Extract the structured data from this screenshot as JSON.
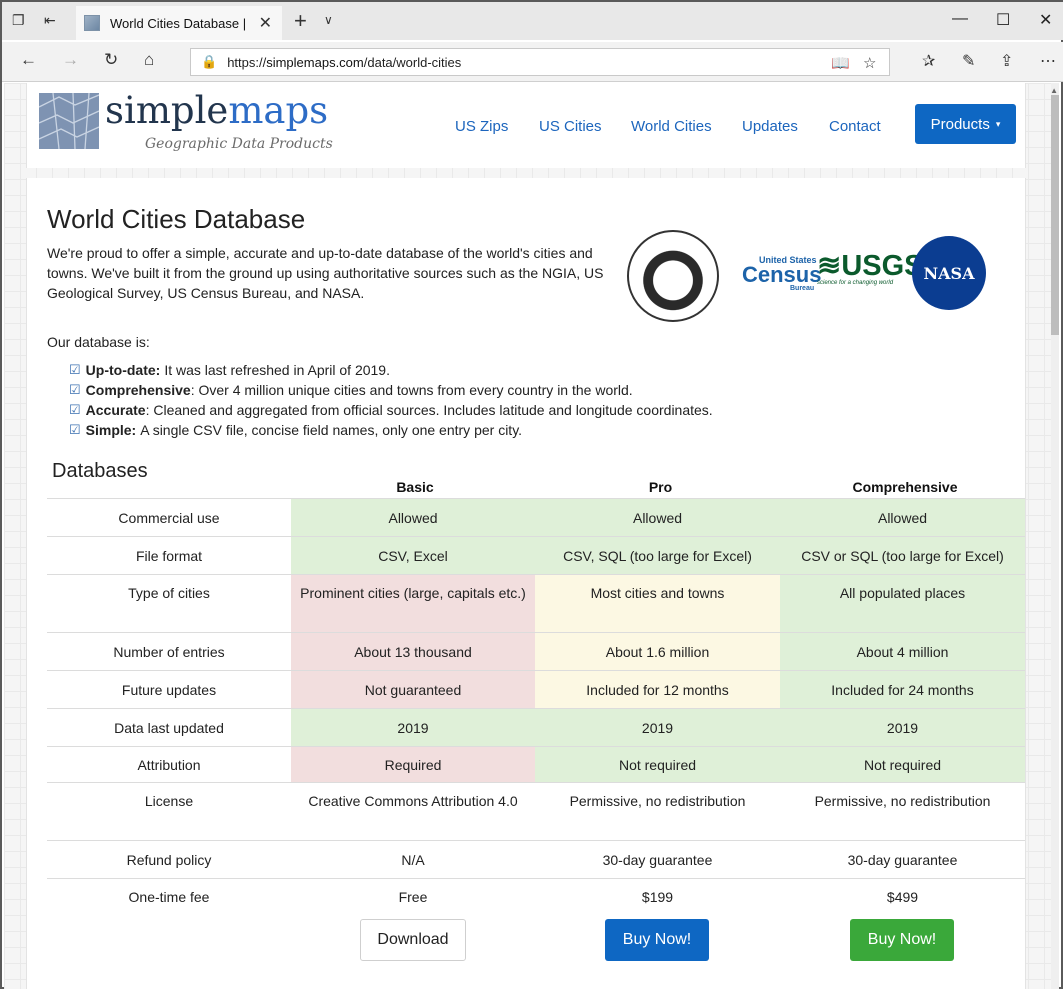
{
  "browser": {
    "tab_title": "World Cities Database |",
    "url_prefix": "https://",
    "url_host": "simplemaps.com",
    "url_path": "/data/world-cities"
  },
  "site": {
    "logo_primary": "simple",
    "logo_accent": "maps",
    "logo_sub": "Geographic Data Products",
    "nav": [
      "US Zips",
      "US Cities",
      "World Cities",
      "Updates",
      "Contact"
    ],
    "products_label": "Products"
  },
  "page": {
    "title": "World Cities Database",
    "intro": "We're proud to offer a simple, accurate and up-to-date database of the world's cities and towns. We've built it from the ground up using authoritative sources such as the NGIA, US Geological Survey, US Census Bureau, and NASA.",
    "db_is": "Our database is:",
    "features": [
      {
        "label": "Up-to-date:",
        "text": "It was last refreshed in April of 2019."
      },
      {
        "label": "Comprehensive",
        "text": ": Over 4 million unique cities and towns from every country in the world."
      },
      {
        "label": "Accurate",
        "text": ": Cleaned and aggregated from official sources. Includes latitude and longitude coordinates."
      },
      {
        "label": "Simple:",
        "text": "A single CSV file, concise field names, only one entry per city."
      }
    ],
    "logos": {
      "census_top": "United States",
      "census_main": "Census",
      "census_bot": "Bureau",
      "usgs": "USGS",
      "usgs_sub": "science for a changing world",
      "nasa": "NASA"
    }
  },
  "databases": {
    "title": "Databases",
    "columns": [
      "Basic",
      "Pro",
      "Comprehensive"
    ],
    "rows": [
      {
        "label": "Commercial use",
        "cells": [
          "Allowed",
          "Allowed",
          "Allowed"
        ],
        "tones": [
          "green",
          "green",
          "green"
        ]
      },
      {
        "label": "File format",
        "cells": [
          "CSV, Excel",
          "CSV, SQL (too large for Excel)",
          "CSV or SQL (too large for Excel)"
        ],
        "tones": [
          "green",
          "green",
          "green"
        ]
      },
      {
        "label": "Type of cities",
        "cells": [
          "Prominent cities (large, capitals etc.)",
          "Most cities and towns",
          "All populated places"
        ],
        "tones": [
          "red",
          "yellow",
          "green"
        ]
      },
      {
        "label": "Number of entries",
        "cells": [
          "About 13 thousand",
          "About 1.6 million",
          "About 4 million"
        ],
        "tones": [
          "red",
          "yellow",
          "green"
        ]
      },
      {
        "label": "Future updates",
        "cells": [
          "Not guaranteed",
          "Included for 12 months",
          "Included for 24 months"
        ],
        "tones": [
          "red",
          "yellow",
          "green"
        ]
      },
      {
        "label": "Data last updated",
        "cells": [
          "2019",
          "2019",
          "2019"
        ],
        "tones": [
          "green",
          "green",
          "green"
        ]
      },
      {
        "label": "Attribution",
        "cells": [
          "Required",
          "Not required",
          "Not required"
        ],
        "tones": [
          "red",
          "green",
          "green"
        ]
      },
      {
        "label": "License",
        "cells": [
          "Creative Commons Attribution 4.0",
          "Permissive, no redistribution",
          "Permissive, no redistribution"
        ],
        "tones": [
          "none",
          "none",
          "none"
        ]
      },
      {
        "label": "Refund policy",
        "cells": [
          "N/A",
          "30-day guarantee",
          "30-day guarantee"
        ],
        "tones": [
          "none",
          "none",
          "none"
        ]
      },
      {
        "label": "One-time fee",
        "cells": [
          "Free",
          "$199",
          "$499"
        ],
        "tones": [
          "none",
          "none",
          "none"
        ]
      }
    ],
    "buttons": [
      "Download",
      "Buy Now!",
      "Buy Now!"
    ]
  },
  "colors": {
    "green": "#dff0d8",
    "red": "#f2dede",
    "yellow": "#fcf8e3",
    "link": "#1c65bd",
    "primary_button": "#0e67c3",
    "success_button": "#3aa83a"
  }
}
